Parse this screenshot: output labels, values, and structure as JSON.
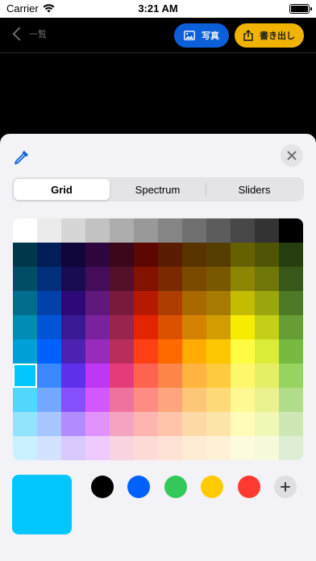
{
  "status_bar": {
    "carrier": "Carrier",
    "time": "3:21 AM"
  },
  "nav": {
    "back_label": "一覧",
    "photo_label": "写真",
    "export_label": "書き出し"
  },
  "picker": {
    "tabs": [
      {
        "label": "Grid",
        "active": true
      },
      {
        "label": "Spectrum",
        "active": false
      },
      {
        "label": "Sliders",
        "active": false
      }
    ],
    "grid_rows": [
      [
        "#ffffff",
        "#ebebeb",
        "#d6d6d6",
        "#c2c2c2",
        "#adadad",
        "#999999",
        "#858585",
        "#707070",
        "#5c5c5c",
        "#474747",
        "#333333",
        "#000000"
      ],
      [
        "#00374a",
        "#011d57",
        "#11053b",
        "#2e063d",
        "#3c071b",
        "#5c0701",
        "#5a1c00",
        "#583300",
        "#563d00",
        "#666100",
        "#4f5504",
        "#263e0f"
      ],
      [
        "#004d65",
        "#012f7b",
        "#1a0a52",
        "#450d59",
        "#551029",
        "#831100",
        "#7b2900",
        "#7a4a00",
        "#785800",
        "#8c8602",
        "#6f760a",
        "#38571a"
      ],
      [
        "#016e8f",
        "#0042a9",
        "#2c0977",
        "#61187c",
        "#791a3d",
        "#b51a00",
        "#ad3e00",
        "#a96800",
        "#a67b01",
        "#c4bc00",
        "#9ba50e",
        "#4e7a27"
      ],
      [
        "#008cb4",
        "#0056d6",
        "#371a94",
        "#7a219e",
        "#99244f",
        "#e22400",
        "#da5100",
        "#d38301",
        "#d19d01",
        "#f5ec00",
        "#c3d017",
        "#669d34"
      ],
      [
        "#00a1d8",
        "#0061fe",
        "#4d22b2",
        "#982abc",
        "#b92d5d",
        "#ff4015",
        "#ff6a00",
        "#ffab01",
        "#fcc700",
        "#fefb41",
        "#d9ec37",
        "#76bb40"
      ],
      [
        "#01c7fc",
        "#3a87fe",
        "#5e30eb",
        "#be38f3",
        "#e63b7a",
        "#fe6250",
        "#fe8648",
        "#feb43f",
        "#fecb3e",
        "#fff76b",
        "#e4ef65",
        "#96d35f"
      ],
      [
        "#52d6fc",
        "#74a7ff",
        "#864ffd",
        "#d357fe",
        "#ee719e",
        "#ff8c82",
        "#fea57d",
        "#fec777",
        "#fed977",
        "#fff994",
        "#eaf28f",
        "#b1dd8b"
      ],
      [
        "#93e3fc",
        "#a7c6ff",
        "#b18cfe",
        "#e292fe",
        "#f4a4c0",
        "#ffb5af",
        "#ffc5ab",
        "#fed9a8",
        "#fde4a8",
        "#fffbb9",
        "#f1f7b7",
        "#cde8b5"
      ],
      [
        "#cbf0ff",
        "#d3e2ff",
        "#d9c9fe",
        "#efcaff",
        "#f9d3e0",
        "#ffdbd8",
        "#ffe2d6",
        "#feecd4",
        "#fef1d5",
        "#fdfbdd",
        "#f6fadb",
        "#deeed4"
      ]
    ],
    "selected_cell": {
      "row": 6,
      "col": 0
    },
    "current_color": "#01c7fc",
    "recent_colors": [
      "#000000",
      "#0061fe",
      "#34c759",
      "#fecb00",
      "#ff3b30"
    ]
  },
  "icons": {
    "wifi": "wifi-icon",
    "battery": "battery-icon",
    "back": "chevron-left-icon",
    "photo": "photo-icon",
    "export": "share-icon",
    "dropper": "eyedropper-icon",
    "close": "close-icon",
    "add": "plus-icon"
  }
}
